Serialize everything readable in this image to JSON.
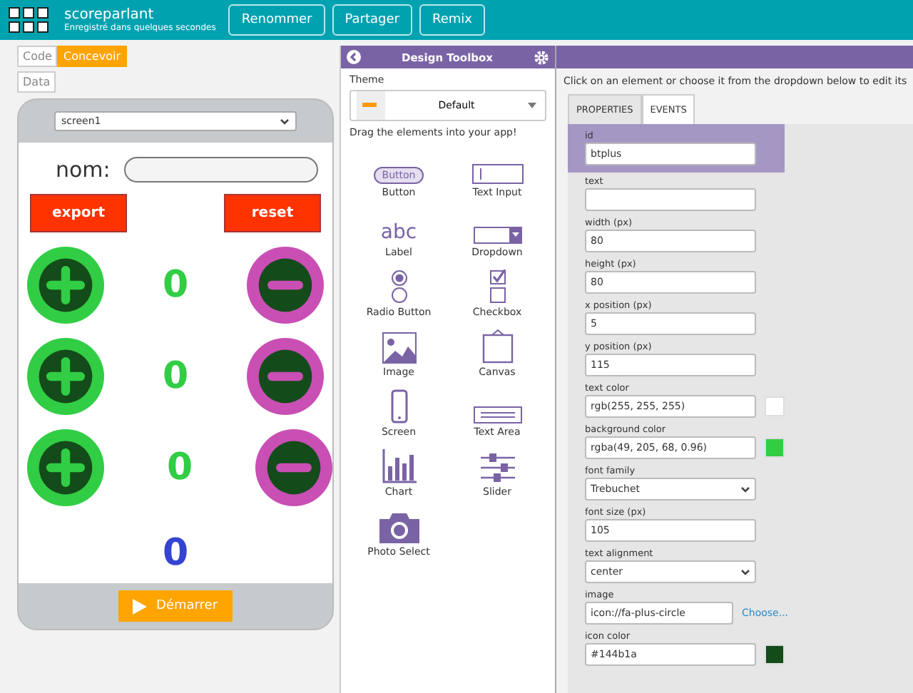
{
  "header": {
    "project_name": "scoreparlant",
    "save_status": "Enregistré dans quelques secondes",
    "buttons": [
      "Renommer",
      "Partager",
      "Remix"
    ]
  },
  "mode_tabs": [
    {
      "label": "Code",
      "selected": false
    },
    {
      "label": "Concevoir",
      "selected": true
    }
  ],
  "data_button": "Data",
  "app_preview": {
    "screen_select": "screen1",
    "name_label": "nom:",
    "action_buttons": [
      "export",
      "reset"
    ],
    "counter_rows": [
      {
        "value": "0"
      },
      {
        "value": "0"
      },
      {
        "value": "0"
      }
    ],
    "total": "0",
    "run_button": "Démarrer"
  },
  "toolbox": {
    "title": "Design Toolbox",
    "theme_label": "Theme",
    "theme_value": "Default",
    "hint": "Drag the elements into your app!",
    "items": [
      {
        "kind": "button",
        "label": "Button",
        "sample": "Button"
      },
      {
        "kind": "textinput",
        "label": "Text Input"
      },
      {
        "kind": "label",
        "label": "Label",
        "sample": "abc"
      },
      {
        "kind": "dropdown",
        "label": "Dropdown"
      },
      {
        "kind": "radio",
        "label": "Radio Button"
      },
      {
        "kind": "checkbox",
        "label": "Checkbox"
      },
      {
        "kind": "image",
        "label": "Image"
      },
      {
        "kind": "canvas",
        "label": "Canvas"
      },
      {
        "kind": "screen",
        "label": "Screen"
      },
      {
        "kind": "textarea",
        "label": "Text Area"
      },
      {
        "kind": "chart",
        "label": "Chart"
      },
      {
        "kind": "slider",
        "label": "Slider"
      },
      {
        "kind": "photo",
        "label": "Photo Select"
      }
    ]
  },
  "properties": {
    "hint": "Click on an element or choose it from the dropdown below to edit its",
    "tabs": [
      {
        "label": "PROPERTIES",
        "selected": true
      },
      {
        "label": "EVENTS",
        "selected": false
      }
    ],
    "fields": [
      {
        "kind": "text",
        "label": "id",
        "value": "btplus",
        "selected": true
      },
      {
        "kind": "text",
        "label": "text",
        "selected": false
      },
      {
        "kind": "text",
        "label": "width (px)",
        "value": "80",
        "selected": false
      },
      {
        "kind": "text",
        "label": "height (px)",
        "value": "80",
        "selected": false
      },
      {
        "kind": "text",
        "label": "x position (px)",
        "value": "5",
        "selected": false
      },
      {
        "kind": "text",
        "label": "y position (px)",
        "value": "115",
        "selected": false
      },
      {
        "kind": "color",
        "label": "text color",
        "value": "rgb(255, 255, 255)",
        "color": "#ffffff",
        "selected": false
      },
      {
        "kind": "color",
        "label": "background color",
        "value": "rgba(49, 205, 68, 0.96)",
        "color": "#31cd44",
        "selected": false
      },
      {
        "kind": "select",
        "label": "font family",
        "value": "Trebuchet",
        "selected": false
      },
      {
        "kind": "text",
        "label": "font size (px)",
        "value": "105",
        "selected": false
      },
      {
        "kind": "select",
        "label": "text alignment",
        "value": "center",
        "selected": false
      },
      {
        "kind": "link",
        "label": "image",
        "value": "icon://fa-plus-circle",
        "link": "Choose...",
        "selected": false
      },
      {
        "kind": "color",
        "label": "icon color",
        "value": "#144b1a",
        "color": "#144b1a",
        "selected": false
      }
    ]
  }
}
